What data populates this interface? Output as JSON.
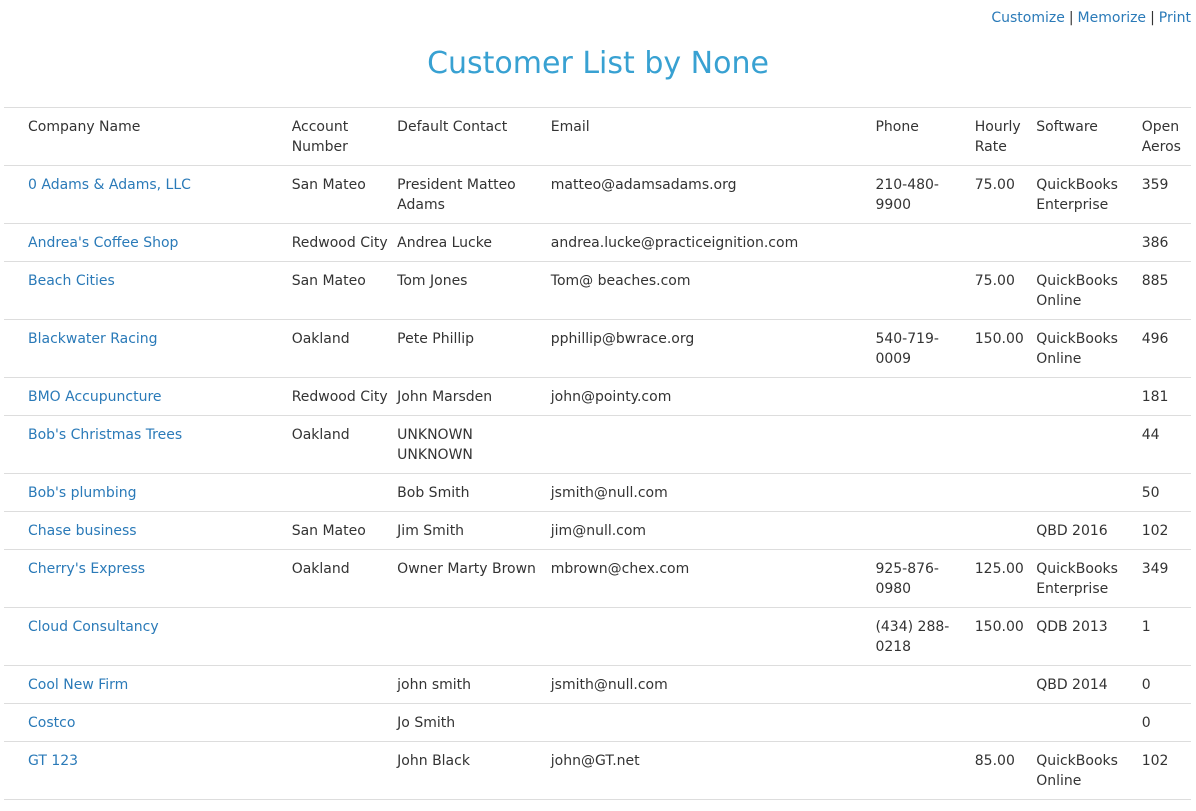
{
  "top_links": {
    "customize": "Customize",
    "memorize": "Memorize",
    "print": "Print",
    "separator": "|"
  },
  "title": "Customer List by None",
  "table": {
    "columns": [
      "Company Name",
      "Account Number",
      "Default Contact",
      "Email",
      "Phone",
      "Hourly Rate",
      "Software",
      "Open Aeros"
    ],
    "rows": [
      {
        "company": "0 Adams & Adams, LLC",
        "account": "San Mateo",
        "contact": "President Matteo Adams",
        "email": "matteo@adamsadams.org",
        "phone": "210-480-9900",
        "rate": "75.00",
        "software": "QuickBooks Enterprise",
        "aeros": "359"
      },
      {
        "company": "Andrea's Coffee Shop",
        "account": "Redwood City",
        "contact": "Andrea Lucke",
        "email": "andrea.lucke@practiceignition.com",
        "phone": "",
        "rate": "",
        "software": "",
        "aeros": "386"
      },
      {
        "company": "Beach Cities",
        "account": "San Mateo",
        "contact": "Tom Jones",
        "email": "Tom@ beaches.com",
        "phone": "",
        "rate": "75.00",
        "software": "QuickBooks Online",
        "aeros": "885"
      },
      {
        "company": "Blackwater Racing",
        "account": "Oakland",
        "contact": "Pete Phillip",
        "email": "pphillip@bwrace.org",
        "phone": "540-719-0009",
        "rate": "150.00",
        "software": "QuickBooks Online",
        "aeros": "496"
      },
      {
        "company": "BMO Accupuncture",
        "account": "Redwood City",
        "contact": "John Marsden",
        "email": "john@pointy.com",
        "phone": "",
        "rate": "",
        "software": "",
        "aeros": "181"
      },
      {
        "company": "Bob's Christmas Trees",
        "account": "Oakland",
        "contact": "UNKNOWN UNKNOWN",
        "email": "",
        "phone": "",
        "rate": "",
        "software": "",
        "aeros": "44"
      },
      {
        "company": "Bob's plumbing",
        "account": "",
        "contact": "Bob Smith",
        "email": "jsmith@null.com",
        "phone": "",
        "rate": "",
        "software": "",
        "aeros": "50"
      },
      {
        "company": "Chase business",
        "account": "San Mateo",
        "contact": "Jim Smith",
        "email": "jim@null.com",
        "phone": "",
        "rate": "",
        "software": "QBD 2016",
        "aeros": "102"
      },
      {
        "company": "Cherry's Express",
        "account": "Oakland",
        "contact": "Owner Marty Brown",
        "email": "mbrown@chex.com",
        "phone": "925-876-0980",
        "rate": "125.00",
        "software": "QuickBooks Enterprise",
        "aeros": "349"
      },
      {
        "company": "Cloud Consultancy",
        "account": "",
        "contact": "",
        "email": "",
        "phone": "(434) 288-0218",
        "rate": "150.00",
        "software": "QDB 2013",
        "aeros": "1"
      },
      {
        "company": "Cool New Firm",
        "account": "",
        "contact": "john smith",
        "email": "jsmith@null.com",
        "phone": "",
        "rate": "",
        "software": "QBD 2014",
        "aeros": "0"
      },
      {
        "company": "Costco",
        "account": "",
        "contact": "Jo Smith",
        "email": "",
        "phone": "",
        "rate": "",
        "software": "",
        "aeros": "0"
      },
      {
        "company": "GT 123",
        "account": "",
        "contact": "John Black",
        "email": "john@GT.net",
        "phone": "",
        "rate": "85.00",
        "software": "QuickBooks Online",
        "aeros": "102"
      }
    ]
  },
  "colors": {
    "title": "#38a1d2",
    "link": "#2a7ab8",
    "border": "#dddddd",
    "text": "#333333"
  }
}
